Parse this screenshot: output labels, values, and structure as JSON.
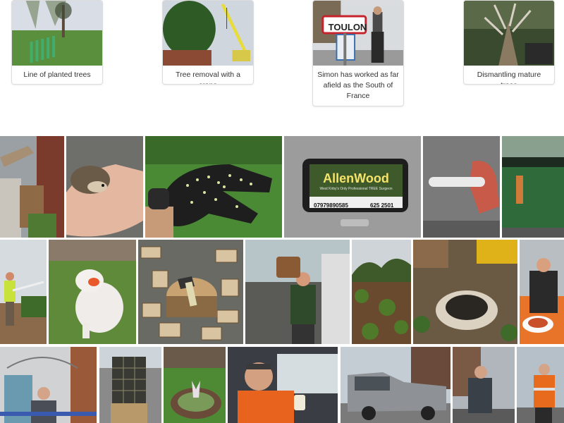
{
  "cards": [
    {
      "caption": "Line of planted trees",
      "scene": "planted-trees-photo"
    },
    {
      "caption": "Tree removal with a crane",
      "scene": "crane-photo"
    },
    {
      "caption": "Simon has worked as far afield as the South of France",
      "scene": "toulon-sign-photo",
      "sign_text": "TOULON"
    },
    {
      "caption": "Dismantling mature trees",
      "scene": "mature-tree-dismantling-photo"
    }
  ],
  "gallery": {
    "row1": [
      {
        "scene": "fallen-fence-and-shed-photo"
      },
      {
        "scene": "hedgehog-in-hand-photo"
      },
      {
        "scene": "seed-covered-glove-photo"
      },
      {
        "scene": "allenwood-van-sign-photo",
        "brand": "AllenWood",
        "tagline": "West Kirby's Only Professional TREE Surgeon",
        "phone1": "07979890585",
        "phone2": "625 2501"
      },
      {
        "scene": "hand-holding-core-photo"
      },
      {
        "scene": "green-van-side-photo"
      }
    ],
    "row2": [
      {
        "scene": "worker-with-pole-photo"
      },
      {
        "scene": "white-dog-with-toy-photo"
      },
      {
        "scene": "split-logs-and-axe-photo"
      },
      {
        "scene": "man-carrying-log-photo"
      },
      {
        "scene": "cleared-hedge-photo"
      },
      {
        "scene": "stump-ground-out-photo"
      },
      {
        "scene": "man-with-spaghetti-plate-photo"
      }
    ],
    "row3": [
      {
        "scene": "man-under-arch-photo"
      },
      {
        "scene": "mesh-bin-on-wood-photo"
      },
      {
        "scene": "garden-ornament-photo"
      },
      {
        "scene": "man-in-van-with-cup-photo"
      },
      {
        "scene": "silver-pickup-truck-photo"
      },
      {
        "scene": "man-in-rain-jacket-photo"
      },
      {
        "scene": "man-in-hi-vis-photo"
      }
    ]
  },
  "colors": {
    "sky": "#b9cde0",
    "grass": "#4f8a3a",
    "foliage": "#2f5e28",
    "earth": "#6b5a44",
    "road": "#8a8a8a",
    "hivis_orange": "#e86a1c",
    "sign_red": "#c8232c",
    "van_green": "#2f6b3a"
  }
}
